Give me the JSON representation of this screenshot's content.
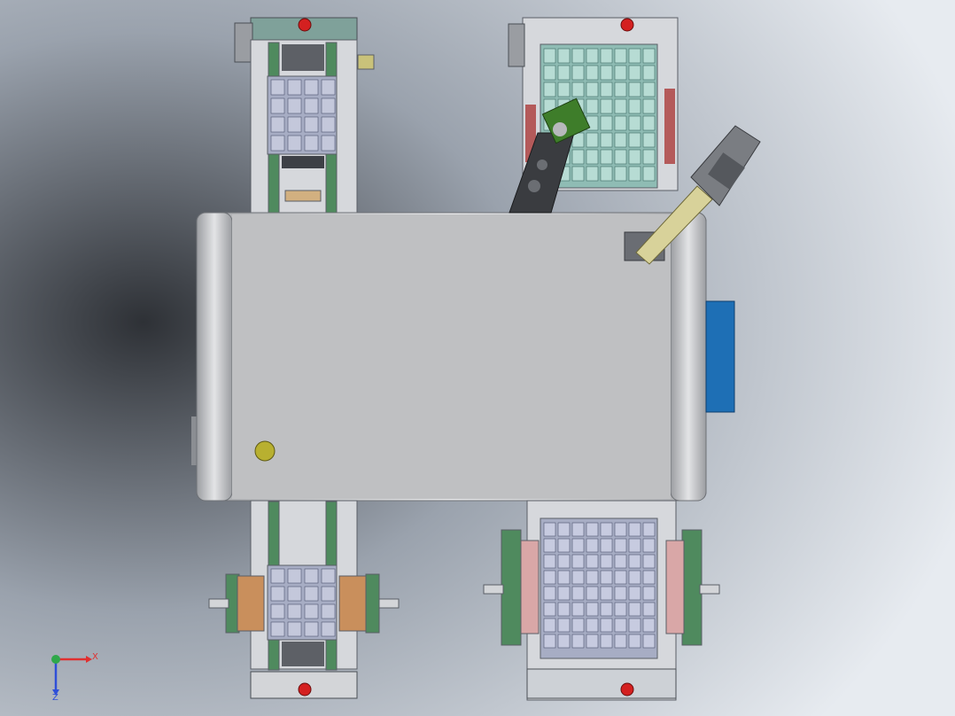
{
  "view": {
    "background": {
      "light": "#e7ebf0",
      "mid": "#9aa2ad",
      "dark": "#2e3136"
    }
  },
  "colors": {
    "frame": "#d6d8dc",
    "frame_edge": "#5a5e66",
    "rail_green": "#4f8a5e",
    "tray_grid": "#8fbcb4",
    "tray_blue": "#a7adc4",
    "pad_tan": "#c98f5c",
    "pink": "#d9a7a7",
    "cabinet": "#bfc0c2",
    "cabinet_edge": "#6f7277",
    "motor_blue": "#1e6fb5",
    "red_button": "#d42020",
    "olive_knob": "#b8b030",
    "robot_dark": "#3a3c40",
    "robot_green": "#3e7d2a",
    "arm_tan": "#d8d29a"
  },
  "triad": {
    "x_label": "X",
    "z_label": "Z",
    "x_color": "#e03030",
    "y_color": "#2fa84a",
    "z_color": "#2f4fd8"
  }
}
